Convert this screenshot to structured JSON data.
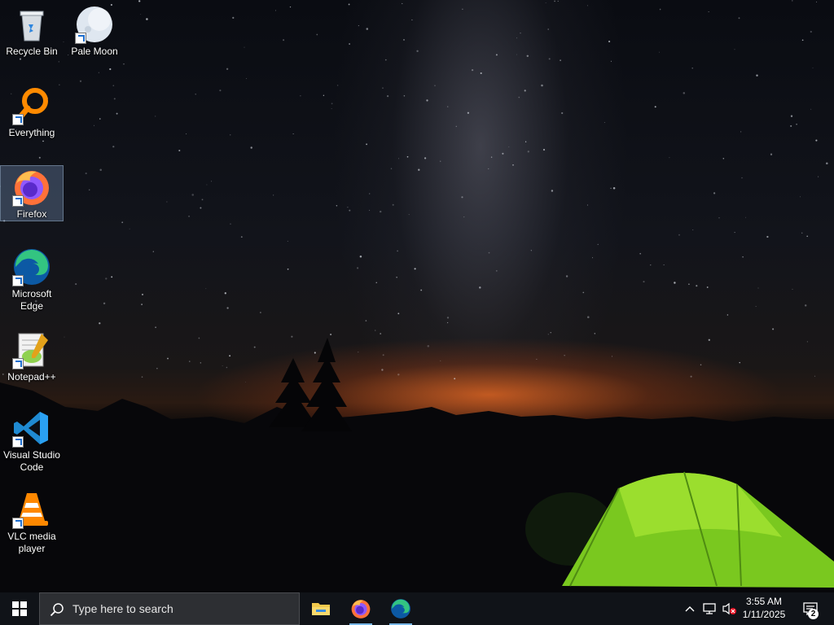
{
  "desktop": {
    "icons": [
      {
        "label": "Recycle Bin",
        "icon": "recycle-bin-icon",
        "shortcut": false,
        "selected": false
      },
      {
        "label": "Pale Moon",
        "icon": "pale-moon-icon",
        "shortcut": true,
        "selected": false
      },
      {
        "label": "Everything",
        "icon": "everything-search-icon",
        "shortcut": true,
        "selected": false
      },
      {
        "label": "Firefox",
        "icon": "firefox-icon",
        "shortcut": true,
        "selected": true
      },
      {
        "label": "Microsoft Edge",
        "icon": "edge-icon",
        "shortcut": true,
        "selected": false
      },
      {
        "label": "Notepad++",
        "icon": "notepad-plus-plus-icon",
        "shortcut": true,
        "selected": false
      },
      {
        "label": "Visual Studio Code",
        "icon": "vscode-icon",
        "shortcut": true,
        "selected": false
      },
      {
        "label": "VLC media player",
        "icon": "vlc-icon",
        "shortcut": true,
        "selected": false
      }
    ]
  },
  "taskbar": {
    "search_placeholder": "Type here to search",
    "apps": [
      {
        "name": "File Explorer",
        "icon": "file-explorer-icon",
        "running": false
      },
      {
        "name": "Firefox",
        "icon": "firefox-icon",
        "running": true
      },
      {
        "name": "Microsoft Edge",
        "icon": "edge-icon",
        "running": true
      }
    ],
    "clock": {
      "time": "3:55 AM",
      "date": "1/11/2025"
    },
    "notification_count": "2"
  },
  "colors": {
    "taskbar_bg": "#101318",
    "accent": "#78b7e8",
    "selection": "#7896be"
  }
}
